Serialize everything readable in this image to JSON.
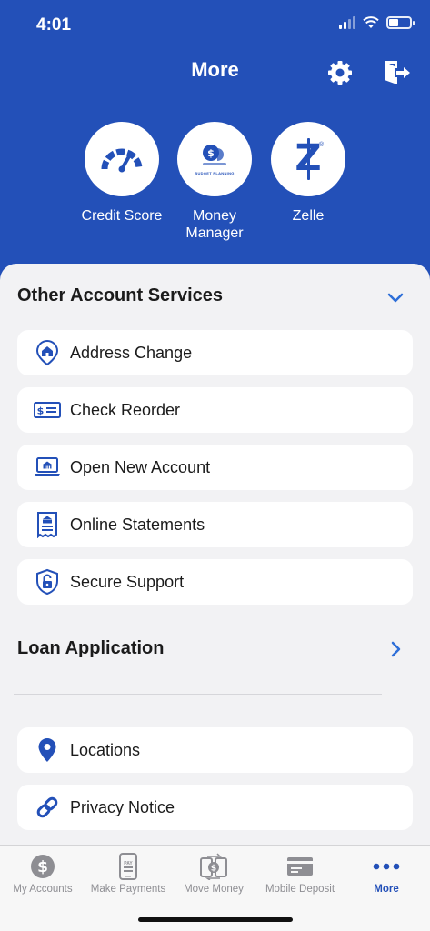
{
  "status_bar": {
    "time": "4:01"
  },
  "header": {
    "title": "More",
    "shortcuts": [
      {
        "label": "Credit Score",
        "icon": "speedometer-icon"
      },
      {
        "label": "Money Manager",
        "icon": "budget-planning-icon",
        "icon_text": "BUDGET PLANNING"
      },
      {
        "label": "Zelle",
        "icon": "zelle-icon",
        "icon_text": "Z"
      }
    ]
  },
  "other_services": {
    "title": "Other Account Services",
    "items": [
      {
        "label": "Address Change",
        "icon": "house-pin-icon"
      },
      {
        "label": "Check Reorder",
        "icon": "check-icon"
      },
      {
        "label": "Open New Account",
        "icon": "laptop-bank-icon"
      },
      {
        "label": "Online Statements",
        "icon": "statement-icon"
      },
      {
        "label": "Secure Support",
        "icon": "shield-lock-icon"
      }
    ]
  },
  "loan_application": {
    "title": "Loan Application"
  },
  "more_items": [
    {
      "label": "Locations",
      "icon": "location-pin-icon"
    },
    {
      "label": "Privacy Notice",
      "icon": "link-icon"
    }
  ],
  "tabbar": {
    "tabs": [
      {
        "label": "My Accounts",
        "icon": "dollar-coin-icon"
      },
      {
        "label": "Make Payments",
        "icon": "phone-pay-icon",
        "icon_text": "PAY"
      },
      {
        "label": "Move Money",
        "icon": "transfer-icon"
      },
      {
        "label": "Mobile Deposit",
        "icon": "check-deposit-icon"
      },
      {
        "label": "More",
        "icon": "more-dots-icon",
        "active": true
      }
    ]
  },
  "colors": {
    "brand_blue": "#2350b8",
    "accent_blue": "#2e6fd8",
    "background": "#f2f2f4",
    "tab_inactive": "#8e8e93"
  }
}
